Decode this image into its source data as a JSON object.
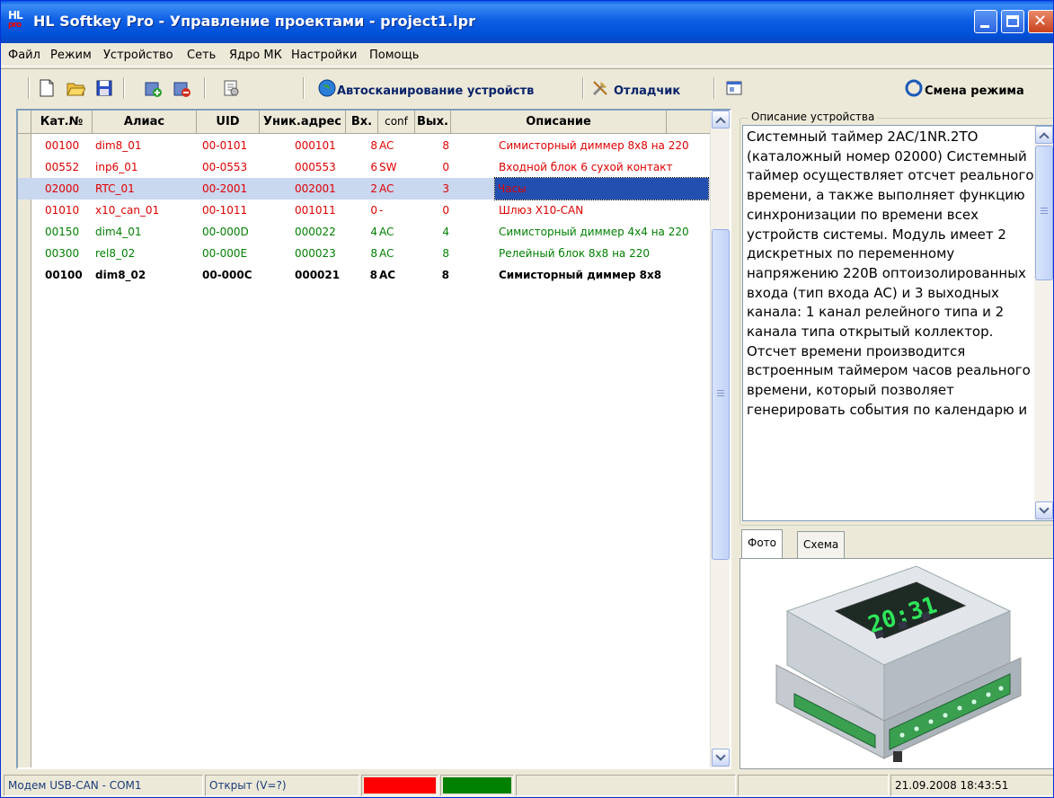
{
  "window": {
    "title": "HL Softkey Pro - Управление проектами - project1.lpr",
    "logo_text": "HL",
    "logo_sub": "pro"
  },
  "menu": [
    "Файл",
    "Режим",
    "Устройство",
    "Сеть",
    "Ядро МК",
    "Настройки",
    "Помощь"
  ],
  "toolbar": {
    "icons": [
      "new-file-icon",
      "open-folder-icon",
      "save-disk-icon",
      "add-device-icon",
      "remove-device-icon",
      "properties-icon",
      "globe-icon",
      "tools-icon",
      "window-icon",
      "mode-switch-icon"
    ],
    "autoscan_label": "Автосканирование устройств",
    "debugger_label": "Отладчик",
    "mode_change_label": "Смена режима"
  },
  "table": {
    "columns": [
      "Кат.№",
      "Алиас",
      "UID",
      "Уник.адрес",
      "Вх.",
      "conf",
      "Вых.",
      "Описание"
    ],
    "rows": [
      {
        "cat": "00100",
        "alias": "dim8_01",
        "uid": "00-0101",
        "addr": "000101",
        "in": "8",
        "conf": "AC",
        "out": "8",
        "desc": "Симисторный диммер 8x8 на 220",
        "color": "red"
      },
      {
        "cat": "00552",
        "alias": "inp6_01",
        "uid": "00-0553",
        "addr": "000553",
        "in": "6",
        "conf": "SW",
        "out": "0",
        "desc": "Входной блок 6 сухой контакт",
        "color": "red"
      },
      {
        "cat": "02000",
        "alias": "RTC_01",
        "uid": "00-2001",
        "addr": "002001",
        "in": "2",
        "conf": "AC",
        "out": "3",
        "desc": "Часы",
        "color": "red",
        "selected": true
      },
      {
        "cat": "01010",
        "alias": "x10_can_01",
        "uid": "00-1011",
        "addr": "001011",
        "in": "0",
        "conf": "-",
        "out": "0",
        "desc": "Шлюз X10-CAN",
        "color": "red"
      },
      {
        "cat": "00150",
        "alias": "dim4_01",
        "uid": "00-000D",
        "addr": "000022",
        "in": "4",
        "conf": "AC",
        "out": "4",
        "desc": "Симисторный диммер 4x4 на 220",
        "color": "green"
      },
      {
        "cat": "00300",
        "alias": "rel8_02",
        "uid": "00-000E",
        "addr": "000023",
        "in": "8",
        "conf": "AC",
        "out": "8",
        "desc": "Релейный блок 8x8 на 220",
        "color": "green"
      },
      {
        "cat": "00100",
        "alias": "dim8_02",
        "uid": "00-000C",
        "addr": "000021",
        "in": "8",
        "conf": "AC",
        "out": "8",
        "desc": "Симисторный диммер 8x8",
        "color": "black"
      }
    ]
  },
  "device_description": {
    "label": "Описание устройства",
    "text": "Системный таймер 2AC/1NR.2TO (каталожный номер 02000) Системный таймер осуществляет отсчет реального времени, а также выполняет функцию синхронизации по времени всех устройств системы. Модуль имеет 2 дискретных по переменному напряжению 220В оптоизолированных входа (тип входа AC) и 3 выходных канала: 1 канал релейного типа и 2 канала типа открытый коллектор. Отсчет времени производится встроенным таймером часов реального времени, который позволяет генерировать события по календарю и"
  },
  "tabs": [
    "Фото",
    "Схема"
  ],
  "photo": {
    "display_text": "20:31"
  },
  "status": {
    "modem": "Модем USB-CAN - COM1",
    "port_state": "Открыт (V=?)",
    "indicator_colors": [
      "#ff0000",
      "#008000"
    ],
    "datetime": "21.09.2008  18:43:51"
  },
  "colors": {
    "title_blue": "#0050d8",
    "row_red": "#e00000",
    "row_green": "#008000",
    "selection": "#2350b0"
  }
}
